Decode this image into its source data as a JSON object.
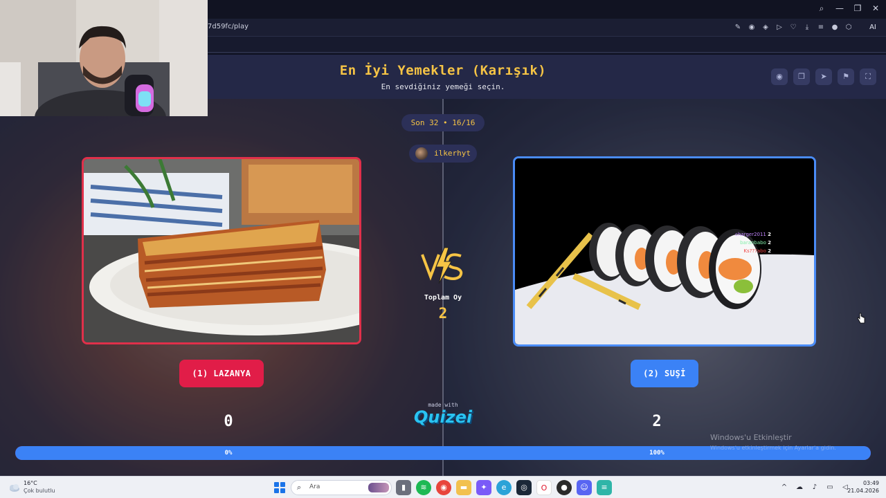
{
  "browser": {
    "url": "7d59fc/play",
    "ai_label": "AI",
    "icons": [
      "edit-icon",
      "camera-icon",
      "shield-icon",
      "play-icon",
      "heart-icon",
      "download-icon",
      "menu-icon",
      "profile-icon",
      "extension-icon"
    ]
  },
  "window": {
    "controls": [
      "search-icon",
      "minimize-icon",
      "restore-icon",
      "close-icon"
    ]
  },
  "quiz": {
    "title": "En İyi Yemekler (Karışık)",
    "subtitle": "En sevdiğiniz yemeği seçin.",
    "round": "Son 32 • 16/16",
    "username": "ilkerhyt",
    "header_buttons": [
      "eye-icon",
      "copy-icon",
      "send-icon",
      "flag-icon",
      "fullscreen-icon"
    ],
    "total_label": "Toplam Oy",
    "total_value": "2",
    "left": {
      "button_label": "(1) LAZANYA",
      "votes": "0",
      "percent_label": "0%",
      "color": "#e11d48",
      "image": "lasagna-photo"
    },
    "right": {
      "button_label": "(2) SUŞİ",
      "votes": "2",
      "percent_label": "100%",
      "color": "#3b82f6",
      "image": "sushi-photo"
    },
    "right_share": 1.0,
    "overlay_votes": [
      {
        "name": "charger2011",
        "count": "2",
        "color": "#c084fc"
      },
      {
        "name": "baranbabo",
        "count": "2",
        "color": "#86efac"
      },
      {
        "name": "Ks???abo",
        "count": "2",
        "color": "#ef4444"
      }
    ],
    "made_with": "made with",
    "brand": "Quizei"
  },
  "watermark": {
    "line1": "Windows'u Etkinleştir",
    "line2": "Windows'u etkinleştirmek için Ayarlar'a gidin."
  },
  "taskbar": {
    "weather_temp": "16°C",
    "weather_desc": "Çok bulutlu",
    "search_placeholder": "Ara",
    "apps": [
      "file-icon",
      "spotify-icon",
      "chrome-icon",
      "folder-icon",
      "copilot-icon",
      "edge-icon",
      "steam-icon",
      "opera-icon",
      "obs-icon",
      "discord-icon",
      "notepad-icon"
    ],
    "time": "03:49",
    "date": "21.04.2026"
  }
}
